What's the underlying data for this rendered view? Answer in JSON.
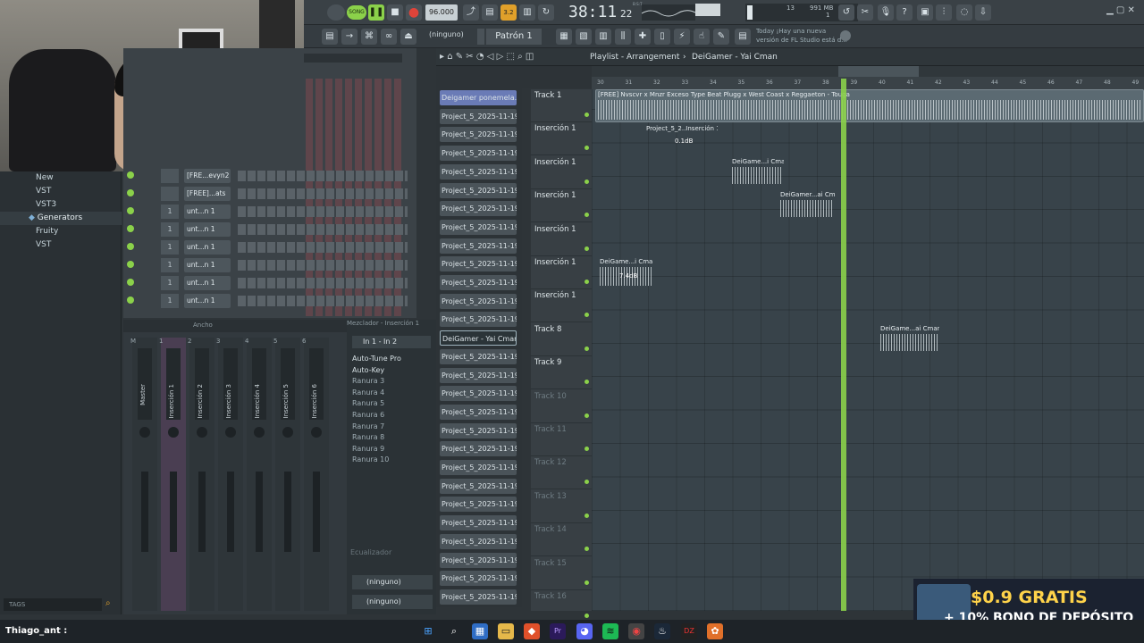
{
  "topbar": {
    "mode": "SONG",
    "tempo": "96.000",
    "time": "38:11",
    "time_sub": "22",
    "time_label": "B:S:T",
    "cpu_num": "13",
    "ram": "991 MB",
    "ram_sub": "1",
    "pattern": "Patrón 1",
    "none": "(ninguno)",
    "news_date": "Today",
    "news_text_1": "¡Hay una nueva",
    "news_text_2": "versión de FL Studio está d..."
  },
  "browser": {
    "items": [
      "New",
      "VST",
      "VST3",
      "Generators",
      "Fruity",
      "VST"
    ],
    "tags_label": "TAGS"
  },
  "channel_rack": {
    "rows": [
      {
        "num": "",
        "name": "[FRE...evyn2"
      },
      {
        "num": "",
        "name": "[FREE]...ats"
      },
      {
        "num": "1",
        "name": "unt...n 1"
      },
      {
        "num": "1",
        "name": "unt...n 1"
      },
      {
        "num": "1",
        "name": "unt...n 1"
      },
      {
        "num": "1",
        "name": "unt...n 1"
      },
      {
        "num": "1",
        "name": "unt...n 1"
      },
      {
        "num": "1",
        "name": "unt...n 1"
      }
    ]
  },
  "mixer": {
    "width_label": "Ancho",
    "title": "Mezclador - Inserción 1",
    "io": "In 1 - In 2",
    "tracks": [
      "Master",
      "Inserción 1",
      "Inserción 2",
      "Inserción 3",
      "Inserción 4",
      "Inserción 5",
      "Inserción 6"
    ],
    "track_nums": [
      "C",
      "M",
      "1",
      "2",
      "3",
      "4",
      "5",
      "6"
    ],
    "slots": [
      "Auto-Tune Pro",
      "Auto-Key",
      "Ranura 3",
      "Ranura 4",
      "Ranura 5",
      "Ranura 6",
      "Ranura 7",
      "Ranura 8",
      "Ranura 9",
      "Ranura 10"
    ],
    "eq_label": "Ecualizador",
    "send1": "(ninguno)",
    "send2": "(ninguno)"
  },
  "playlist": {
    "title": "Playlist - Arrangement",
    "separator": "›",
    "pattern_name": "DeiGamer - Yai Cman",
    "ruler": [
      "30",
      "31",
      "32",
      "33",
      "34",
      "35",
      "36",
      "37",
      "38",
      "39",
      "40",
      "41",
      "42",
      "43",
      "44",
      "45",
      "46",
      "47",
      "48",
      "49"
    ],
    "patterns": [
      "Deigamer ponemela..",
      "Project_5_2025-11-19 2..",
      "Project_5_2025-11-19 2..",
      "Project_5_2025-11-19 2..",
      "Project_5_2025-11-19 2..",
      "Project_5_2025-11-19 2..",
      "Project_5_2025-11-19 2..",
      "Project_5_2025-11-19 2..",
      "Project_5_2025-11-19 2..",
      "Project_5_2025-11-19 2..",
      "Project_5_2025-11-19 2..",
      "Project_5_2025-11-19 2..",
      "Project_5_2025-11-19 2..",
      "DeiGamer - Yai Cman",
      "Project_5_2025-11-19 2..",
      "Project_5_2025-11-19 2..",
      "Project_5_2025-11-19 2..",
      "Project_5_2025-11-19 2..",
      "Project_5_2025-11-19 2..",
      "Project_5_2025-11-19 2..",
      "Project_5_2025-11-19 2..",
      "Project_5_2025-11-19 2..",
      "Project_5_2025-11-19 2..",
      "Project_5_2025-11-19 2..",
      "Project_5_2025-11-19 2..",
      "Project_5_2025-11-19 2..",
      "Project_5_2025-11-19 2..",
      "Project_5_2025-11-19 2.."
    ],
    "tracks": [
      "Track 1",
      "Inserción 1",
      "Inserción 1",
      "Inserción 1",
      "Inserción 1",
      "Inserción 1",
      "Inserción 1",
      "Track 8",
      "Track 9",
      "Track 10",
      "Track 11",
      "Track 12",
      "Track 13",
      "Track 14",
      "Track 15",
      "Track 16"
    ],
    "clips": [
      {
        "label": "[FREE] Nvscvr x Mnzr Exceso Type Beat  Plugg x West Coast x Reggaeton - Touga"
      },
      {
        "label": "Project_5_2..Inserción 1",
        "gain": "0.1dB"
      },
      {
        "label": "DeiGame...i Cman"
      },
      {
        "label": "DeiGamer...ai Cman"
      },
      {
        "label": "DeiGame...i Cman",
        "gain": "7.4dB"
      },
      {
        "label": "DeiGame...ai Cman"
      }
    ]
  },
  "promo": {
    "line1": "$0.9 GRATIS",
    "line2": "+ 10% BONO DE DEPÓSITO"
  },
  "stream_user": "Thiago_ant :",
  "accent_green": "#8bd14a",
  "record_red": "#e0443a"
}
